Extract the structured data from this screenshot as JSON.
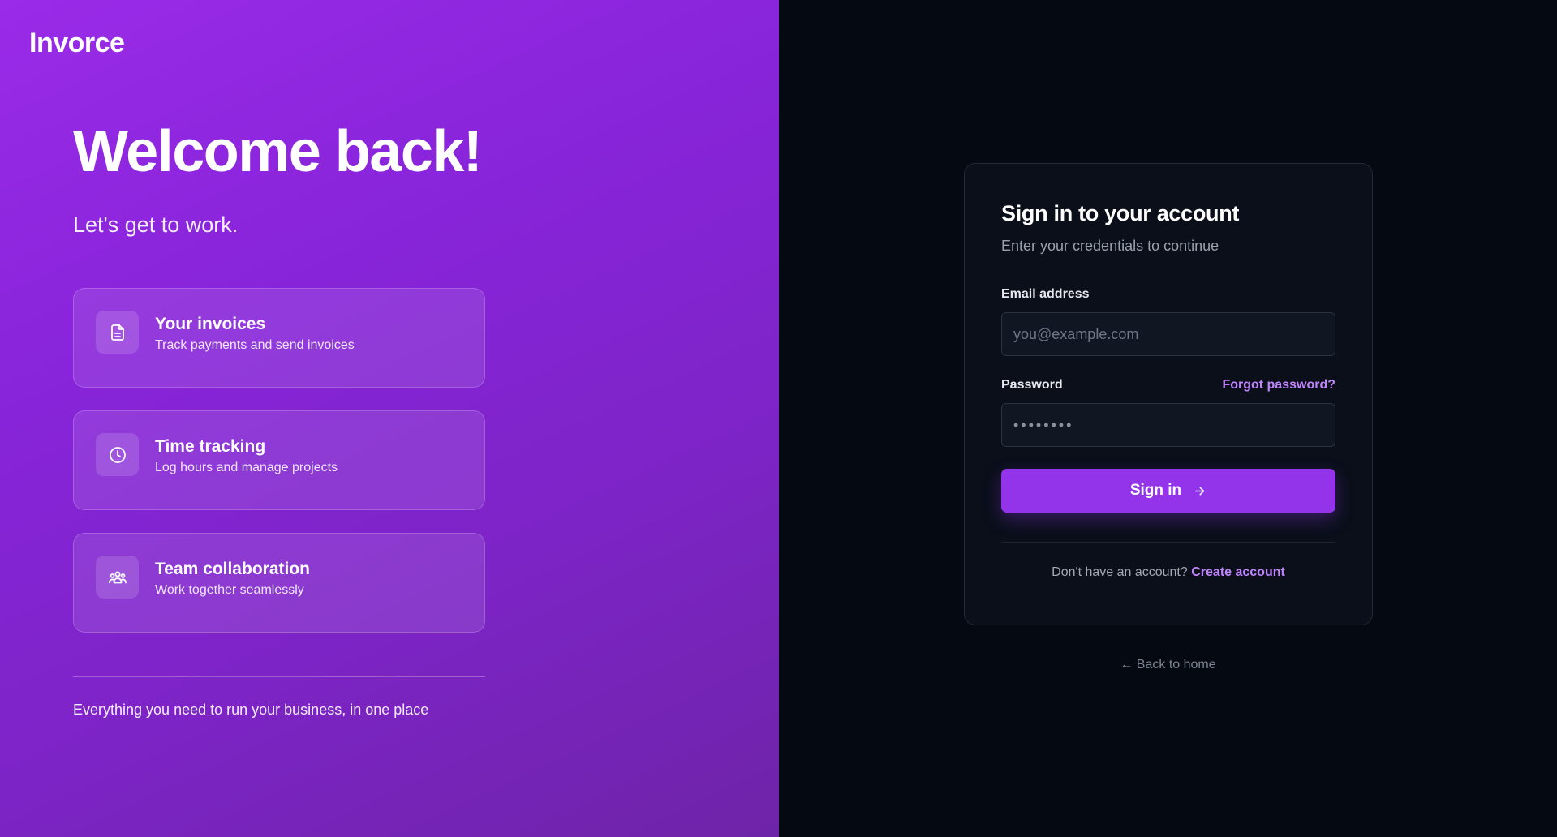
{
  "hero": {
    "brand": "Invorce",
    "title": "Welcome back!",
    "subtitle": "Let's get to work.",
    "features": [
      {
        "icon": "document-icon",
        "title": "Your invoices",
        "description": "Track payments and send invoices"
      },
      {
        "icon": "clock-icon",
        "title": "Time tracking",
        "description": "Log hours and manage projects"
      },
      {
        "icon": "team-icon",
        "title": "Team collaboration",
        "description": "Work together seamlessly"
      }
    ],
    "footer": "Everything you need to run your business, in one place"
  },
  "login": {
    "title": "Sign in to your account",
    "subtitle": "Enter your credentials to continue",
    "email_label": "Email address",
    "email_placeholder": "you@example.com",
    "password_label": "Password",
    "forgot_label": "Forgot password?",
    "password_placeholder": "••••••••",
    "signin_label": "Sign in",
    "no_account_text": "Don't have an account?",
    "create_account_label": "Create account",
    "back_label": "← Back to home"
  },
  "colors": {
    "accent": "#9333ea",
    "link": "#c084fc",
    "panel_bg": "#050912",
    "card_bg": "#0a0f1a"
  }
}
